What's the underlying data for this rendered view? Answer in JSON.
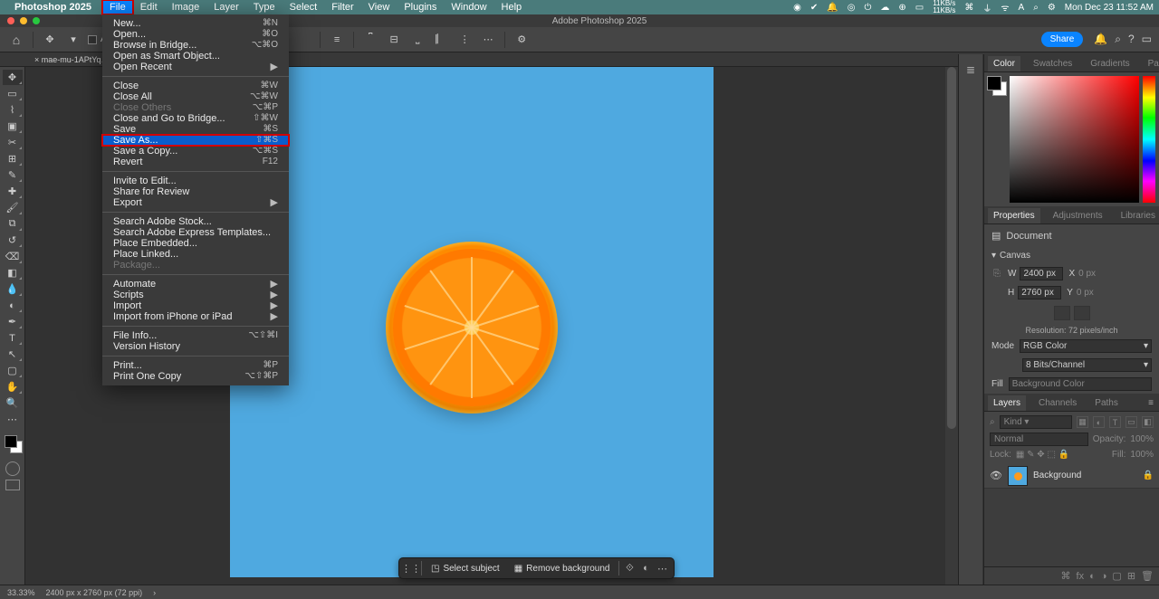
{
  "menubar": {
    "app": "Photoshop 2025",
    "items": [
      "File",
      "Edit",
      "Image",
      "Layer",
      "Type",
      "Select",
      "Filter",
      "View",
      "Plugins",
      "Window",
      "Help"
    ],
    "datetime": "Mon Dec 23  11:52 AM",
    "net": "11KB/s\n11KB/s"
  },
  "window_title": "Adobe Photoshop 2025",
  "options_bar": {
    "auto_select_label": "Auto-Se",
    "share": "Share"
  },
  "doc_tab": "mae-mu-1APtYq…",
  "file_menu": [
    {
      "label": "New...",
      "shortcut": "⌘N"
    },
    {
      "label": "Open...",
      "shortcut": "⌘O"
    },
    {
      "label": "Browse in Bridge...",
      "shortcut": "⌥⌘O"
    },
    {
      "label": "Open as Smart Object..."
    },
    {
      "label": "Open Recent",
      "sub": "▶"
    },
    {
      "sep": true
    },
    {
      "label": "Close",
      "shortcut": "⌘W"
    },
    {
      "label": "Close All",
      "shortcut": "⌥⌘W"
    },
    {
      "label": "Close Others",
      "shortcut": "⌥⌘P",
      "disabled": true
    },
    {
      "label": "Close and Go to Bridge...",
      "shortcut": "⇧⌘W"
    },
    {
      "label": "Save",
      "shortcut": "⌘S"
    },
    {
      "label": "Save As...",
      "shortcut": "⇧⌘S",
      "hi": true
    },
    {
      "label": "Save a Copy...",
      "shortcut": "⌥⌘S"
    },
    {
      "label": "Revert",
      "shortcut": "F12"
    },
    {
      "sep": true
    },
    {
      "label": "Invite to Edit..."
    },
    {
      "label": "Share for Review"
    },
    {
      "label": "Export",
      "sub": "▶"
    },
    {
      "sep": true
    },
    {
      "label": "Search Adobe Stock..."
    },
    {
      "label": "Search Adobe Express Templates..."
    },
    {
      "label": "Place Embedded..."
    },
    {
      "label": "Place Linked..."
    },
    {
      "label": "Package...",
      "disabled": true
    },
    {
      "sep": true
    },
    {
      "label": "Automate",
      "sub": "▶"
    },
    {
      "label": "Scripts",
      "sub": "▶"
    },
    {
      "label": "Import",
      "sub": "▶"
    },
    {
      "label": "Import from iPhone or iPad",
      "sub": "▶"
    },
    {
      "sep": true
    },
    {
      "label": "File Info...",
      "shortcut": "⌥⇧⌘I"
    },
    {
      "label": "Version History"
    },
    {
      "sep": true
    },
    {
      "label": "Print...",
      "shortcut": "⌘P"
    },
    {
      "label": "Print One Copy",
      "shortcut": "⌥⇧⌘P"
    }
  ],
  "panels": {
    "color_tabs": [
      "Color",
      "Swatches",
      "Gradients",
      "Patterns"
    ],
    "props_tabs": [
      "Properties",
      "Adjustments",
      "Libraries"
    ],
    "layers_tabs": [
      "Layers",
      "Channels",
      "Paths"
    ]
  },
  "properties": {
    "doc_label": "Document",
    "canvas_hdr": "Canvas",
    "w_label": "W",
    "w": "2400 px",
    "x_label": "X",
    "x": "0 px",
    "h_label": "H",
    "h": "2760 px",
    "y_label": "Y",
    "y": "0 px",
    "resolution": "Resolution: 72 pixels/inch",
    "mode_label": "Mode",
    "mode": "RGB Color",
    "depth": "8 Bits/Channel",
    "fill_label": "Fill",
    "fill": "Background Color"
  },
  "layers": {
    "kind_label": "Kind",
    "blend": "Normal",
    "opacity_label": "Opacity:",
    "opacity": "100%",
    "lock_label": "Lock:",
    "fill_label": "Fill:",
    "fill": "100%",
    "layer0": "Background"
  },
  "context_bar": {
    "select_subject": "Select subject",
    "remove_bg": "Remove background"
  },
  "status": {
    "zoom": "33.33%",
    "docinfo": "2400 px x 2760 px (72 ppi)"
  }
}
